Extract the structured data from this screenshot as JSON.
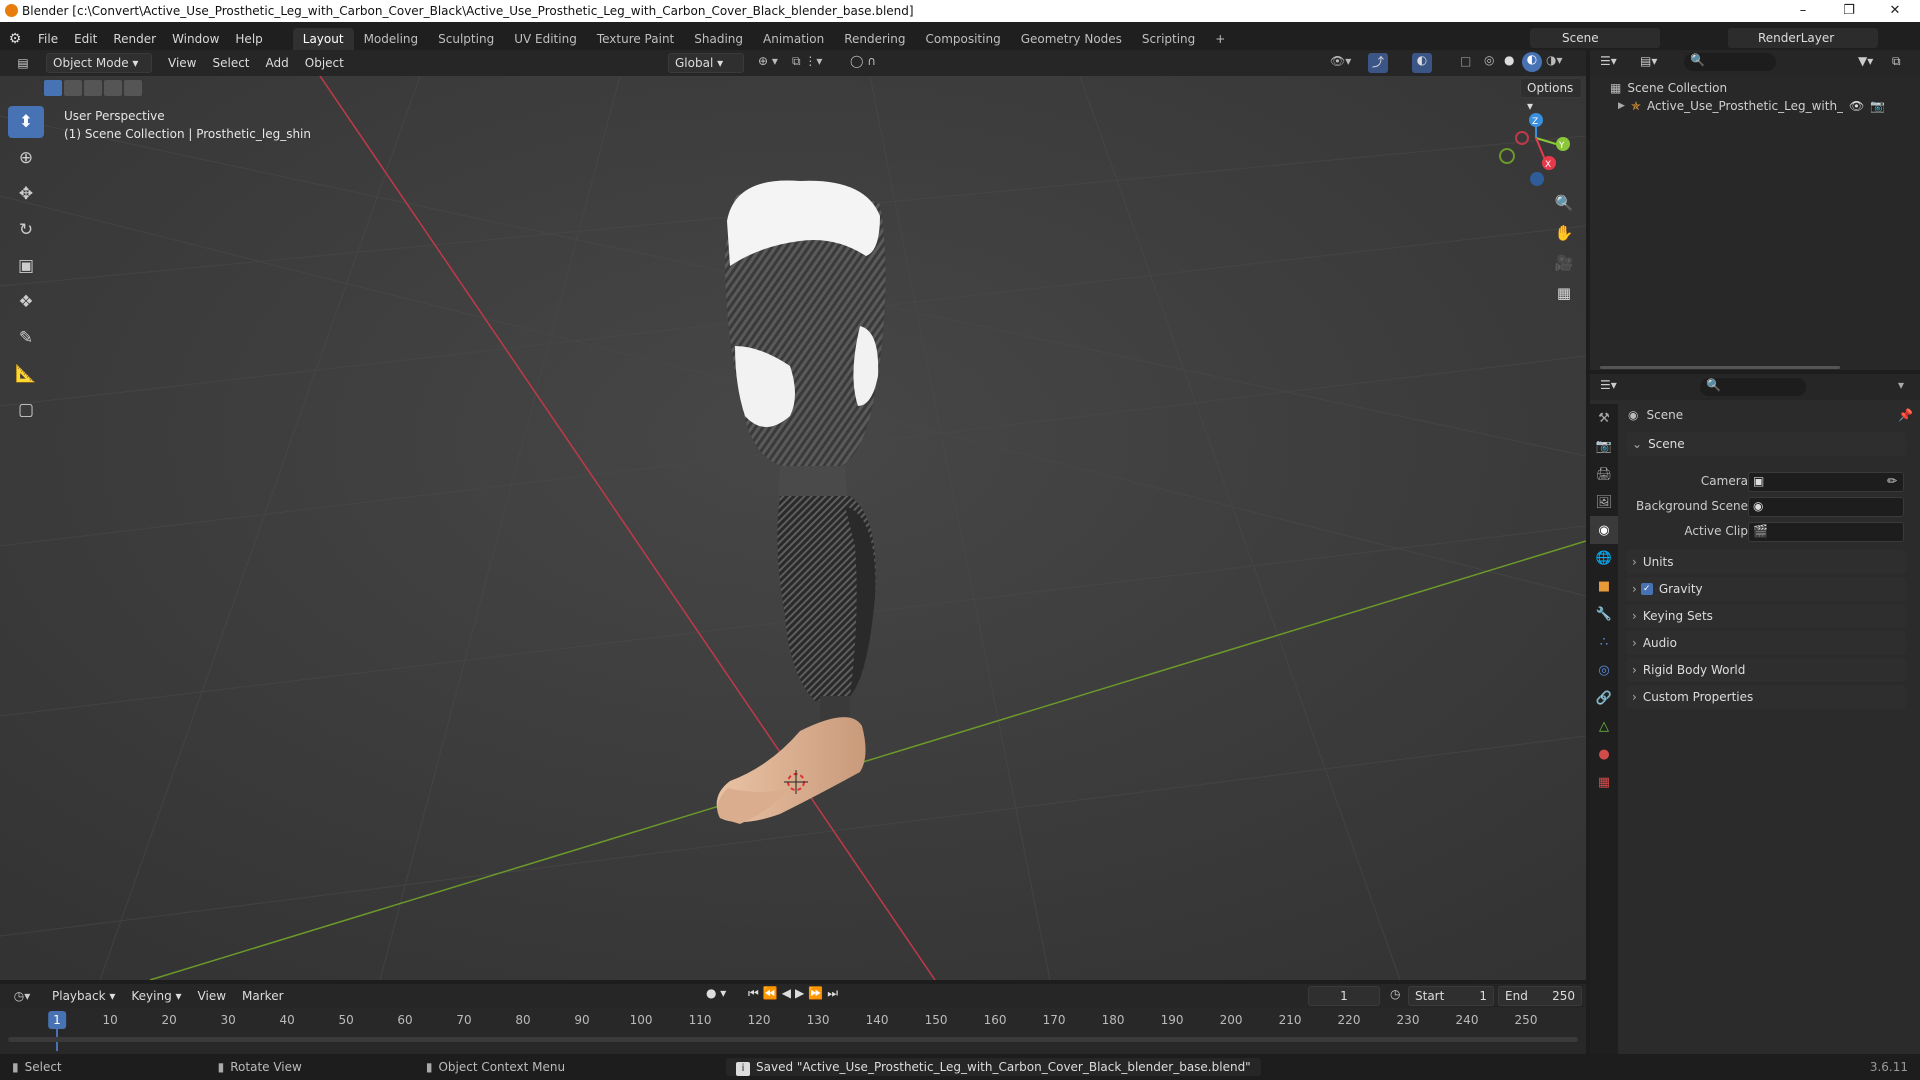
{
  "window": {
    "title": "Blender [c:\\Convert\\Active_Use_Prosthetic_Leg_with_Carbon_Cover_Black\\Active_Use_Prosthetic_Leg_with_Carbon_Cover_Black_blender_base.blend]",
    "minimize": "–",
    "maximize": "❐",
    "close": "✕"
  },
  "menu": {
    "items": [
      "File",
      "Edit",
      "Render",
      "Window",
      "Help"
    ],
    "workspaces": [
      "Layout",
      "Modeling",
      "Sculpting",
      "UV Editing",
      "Texture Paint",
      "Shading",
      "Animation",
      "Rendering",
      "Compositing",
      "Geometry Nodes",
      "Scripting"
    ],
    "add_tab": "+",
    "scene_label": "Scene",
    "renderlayer_label": "RenderLayer"
  },
  "viewport_header": {
    "mode": "Object Mode",
    "view": "View",
    "select": "Select",
    "add": "Add",
    "object": "Object",
    "transform_orientation": "Global",
    "options": "Options"
  },
  "viewport_overlay": {
    "perspective": "User Perspective",
    "collection_info": "(1) Scene Collection | Prosthetic_leg_shin"
  },
  "gizmo": {
    "axis_x": "X",
    "axis_y": "Y",
    "axis_z": "Z",
    "color_x": "#e8394a",
    "color_y": "#8bc53a",
    "color_z": "#3a8fde"
  },
  "outliner": {
    "collection": "Scene Collection",
    "object": "Active_Use_Prosthetic_Leg_with_Carbo"
  },
  "properties": {
    "header": "Scene",
    "section": "Scene",
    "fields": [
      {
        "label": "Camera"
      },
      {
        "label": "Background Scene"
      },
      {
        "label": "Active Clip"
      }
    ],
    "panels": [
      "Units",
      "Gravity",
      "Keying Sets",
      "Audio",
      "Rigid Body World",
      "Custom Properties"
    ],
    "gravity_checked": true
  },
  "timeline": {
    "playback": "Playback",
    "keying": "Keying",
    "view": "View",
    "marker": "Marker",
    "current_frame": "1",
    "start_label": "Start",
    "start": "1",
    "end_label": "End",
    "end": "250",
    "ruler": [
      "1",
      "10",
      "20",
      "30",
      "40",
      "50",
      "60",
      "70",
      "80",
      "90",
      "100",
      "110",
      "120",
      "130",
      "140",
      "150",
      "160",
      "170",
      "180",
      "190",
      "200",
      "210",
      "220",
      "230",
      "240",
      "250"
    ]
  },
  "status": {
    "select": "Select",
    "rotate": "Rotate View",
    "context": "Object Context Menu",
    "message": "Saved \"Active_Use_Prosthetic_Leg_with_Carbon_Cover_Black_blender_base.blend\"",
    "version": "3.6.11"
  },
  "colors": {
    "accent": "#4772b3",
    "x_axis": "#c0394a",
    "y_axis": "#6b9a2a"
  }
}
